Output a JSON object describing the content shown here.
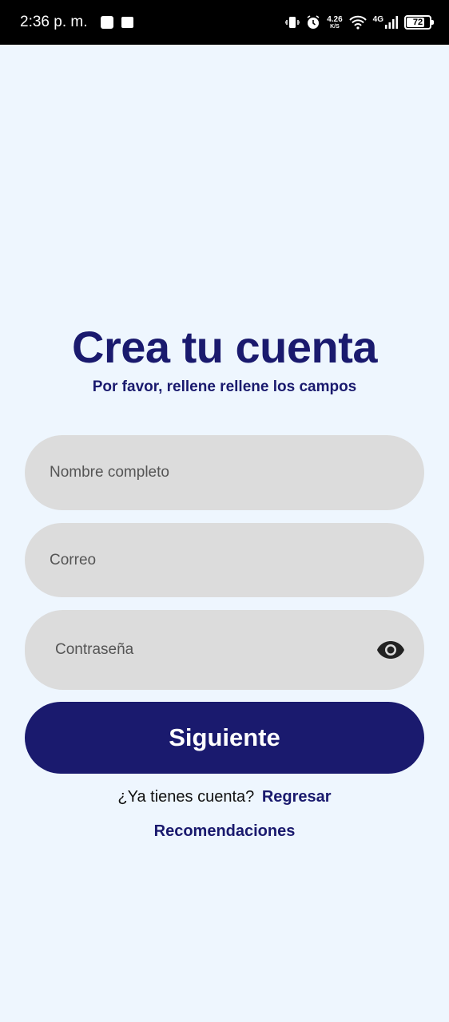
{
  "status_bar": {
    "time": "2:36 p. m.",
    "speed_value": "4.26",
    "speed_unit": "K/S",
    "network": "4G",
    "battery": "72",
    "icons": [
      "notification-icon",
      "square-icon",
      "vibrate-icon",
      "alarm-icon",
      "wifi-icon",
      "signal-icon",
      "battery-icon"
    ]
  },
  "header": {
    "title": "Crea tu cuenta",
    "subtitle": "Por favor, rellene rellene los campos"
  },
  "form": {
    "name_placeholder": "Nombre completo",
    "email_placeholder": "Correo",
    "password_placeholder": "Contraseña",
    "submit_label": "Siguiente"
  },
  "footer": {
    "have_account_text": "¿Ya tienes cuenta?",
    "back_link": "Regresar",
    "recommendations_link": "Recomendaciones"
  },
  "colors": {
    "background": "#eef6fe",
    "primary": "#1a1a6e",
    "field_bg": "#dcdcdc"
  }
}
